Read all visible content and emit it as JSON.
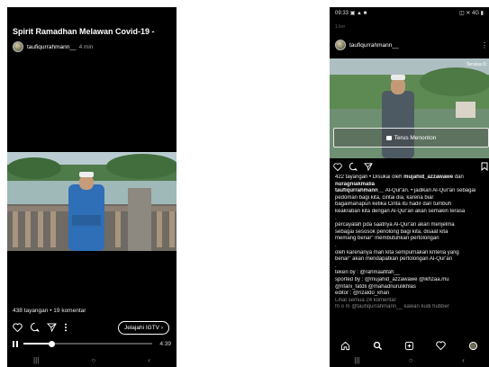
{
  "igtv": {
    "title": "Spirit Ramadhan Melawan Covid-19 -",
    "username": "taufiqurrahmann__",
    "duration": "4 min",
    "stats": "438 tayangan • 19 komentar",
    "explore_label": "Jelajahi IGTV ›",
    "time_remaining": "4:39",
    "progress": 0.22,
    "icons": [
      "heart-icon",
      "comment-icon",
      "send-icon",
      "more-icon",
      "pause-icon"
    ]
  },
  "post": {
    "status_time": "09:33",
    "status_left_icons": "▣ ▲ ■",
    "status_right_icons": "◫ ✕ 4G ▮",
    "ghost_line": "1 kor",
    "username": "taufiqurrahmann__",
    "video_label": "Tersisa 0:",
    "watch_label": "Terus Menonton",
    "likes_line": "422 tayangan • Disukai oleh",
    "liked_by": "mujahid_azzawawe",
    "liked_and": "dan",
    "liked_others": "nuragniakmalia",
    "caption_user": "taufiqurrahmann__",
    "caption_lines": [
      "Al-Qur'an. • jadikan Al-Qur'an sebagai",
      "pedoman bagi kita,  cintai dia,  karena biar",
      "bagaimanapun ketika Cinta itu hadir dan tumbuh",
      "keakraban kita dengan Al-Qur'an akan semakin terasa",
      ".",
      "percayalah pda saatnya Al-Qur'an akan menjelma",
      "sebagai sesosok penolong bagi kita,  disaat kita",
      "memang benar\" membutuhkan pertolongan",
      ".",
      "oleh karenanya mari kita sempurnakan kriteria yang",
      "benar\" akan mendapatkan pertolongan Al-Qur'an",
      ".",
      "teken by : @rahmaafifah__",
      "sported by : @mujahid_azzawawe @ikhzaa.mu",
      "@rifani_fatdli  @mahadnurulikhlas",
      "editor : @rizaldo_khan"
    ],
    "view_comments": "Lihat semua 24 komentar",
    "cut_line": "fn o m  @taufiqurrahmann__  kawan kudi hubber"
  },
  "system_nav": [
    "|||",
    "○",
    "‹"
  ]
}
